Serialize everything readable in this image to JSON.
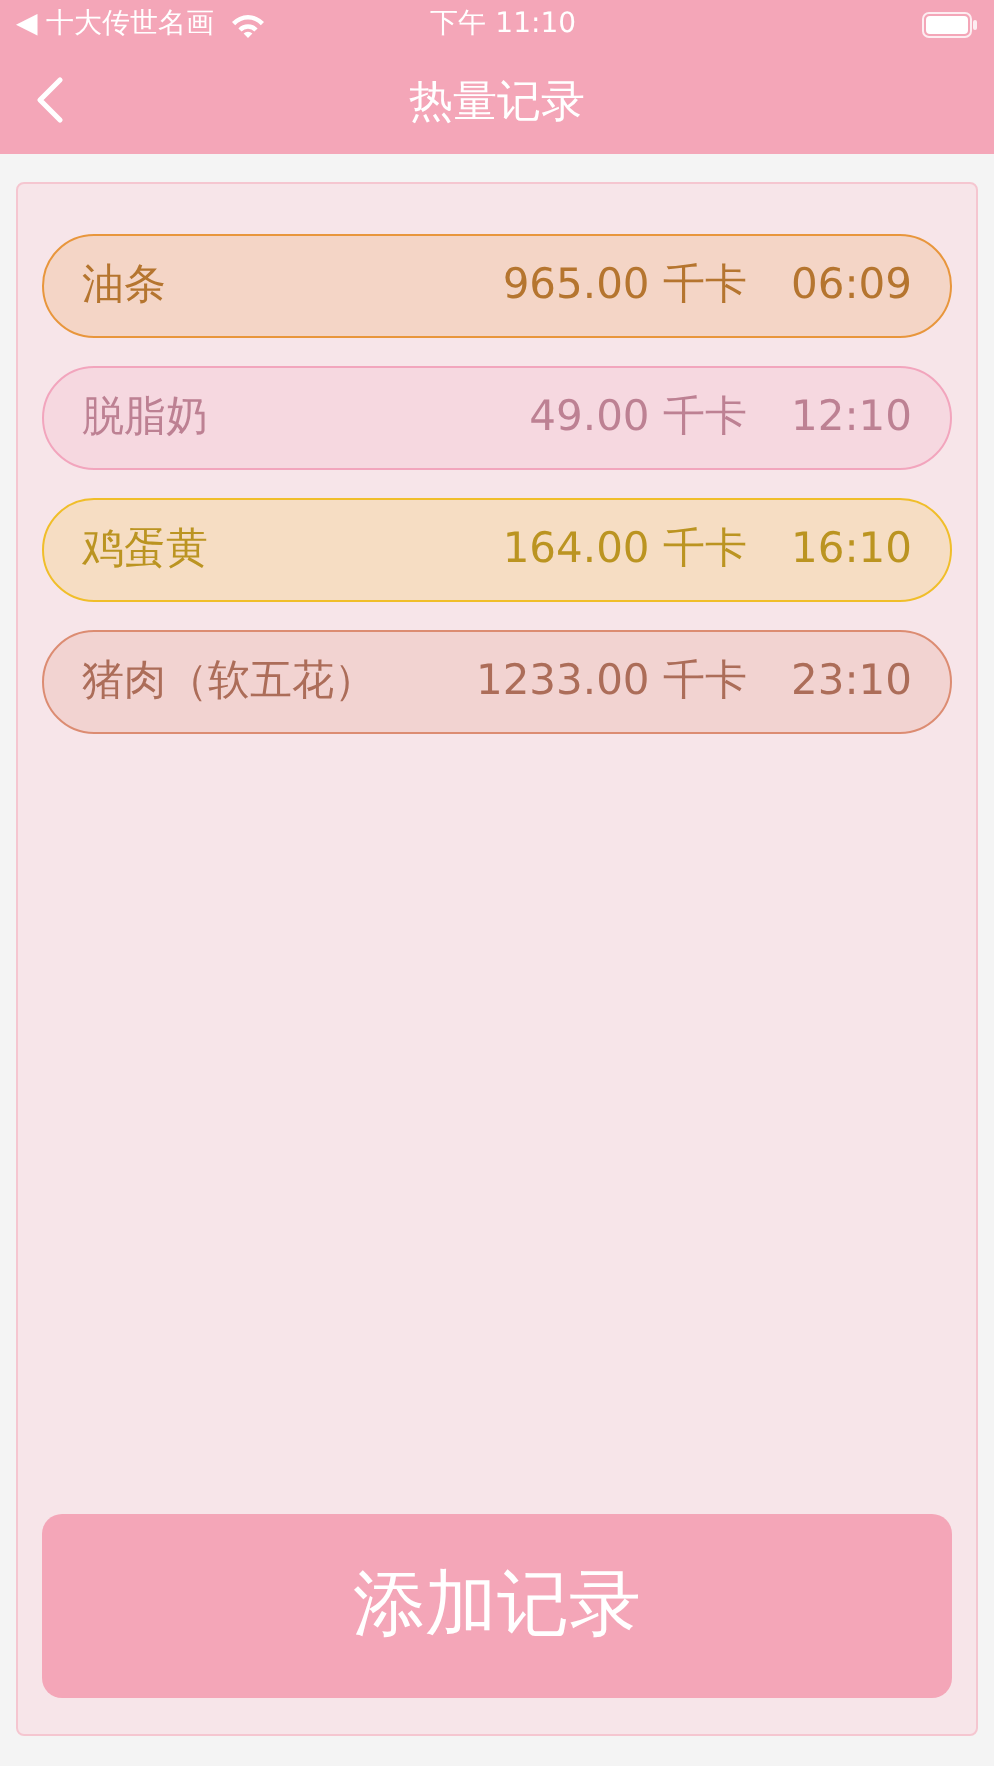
{
  "status_bar": {
    "back_app": "◀ 十大传世名画",
    "time": "下午 11:10"
  },
  "nav": {
    "title": "热量记录"
  },
  "records": [
    {
      "name": "油条",
      "calories": "965.00 千卡",
      "time": "06:09",
      "color": "#e8963c"
    },
    {
      "name": "脱脂奶",
      "calories": "49.00 千卡",
      "time": "12:10",
      "color": "#f2a5bd"
    },
    {
      "name": "鸡蛋黄",
      "calories": "164.00 千卡",
      "time": "16:10",
      "color": "#f0be2a"
    },
    {
      "name": "猪肉（软五花）",
      "calories": "1233.00 千卡",
      "time": "23:10",
      "color": "#dc8c72"
    }
  ],
  "add_button": "添加记录"
}
